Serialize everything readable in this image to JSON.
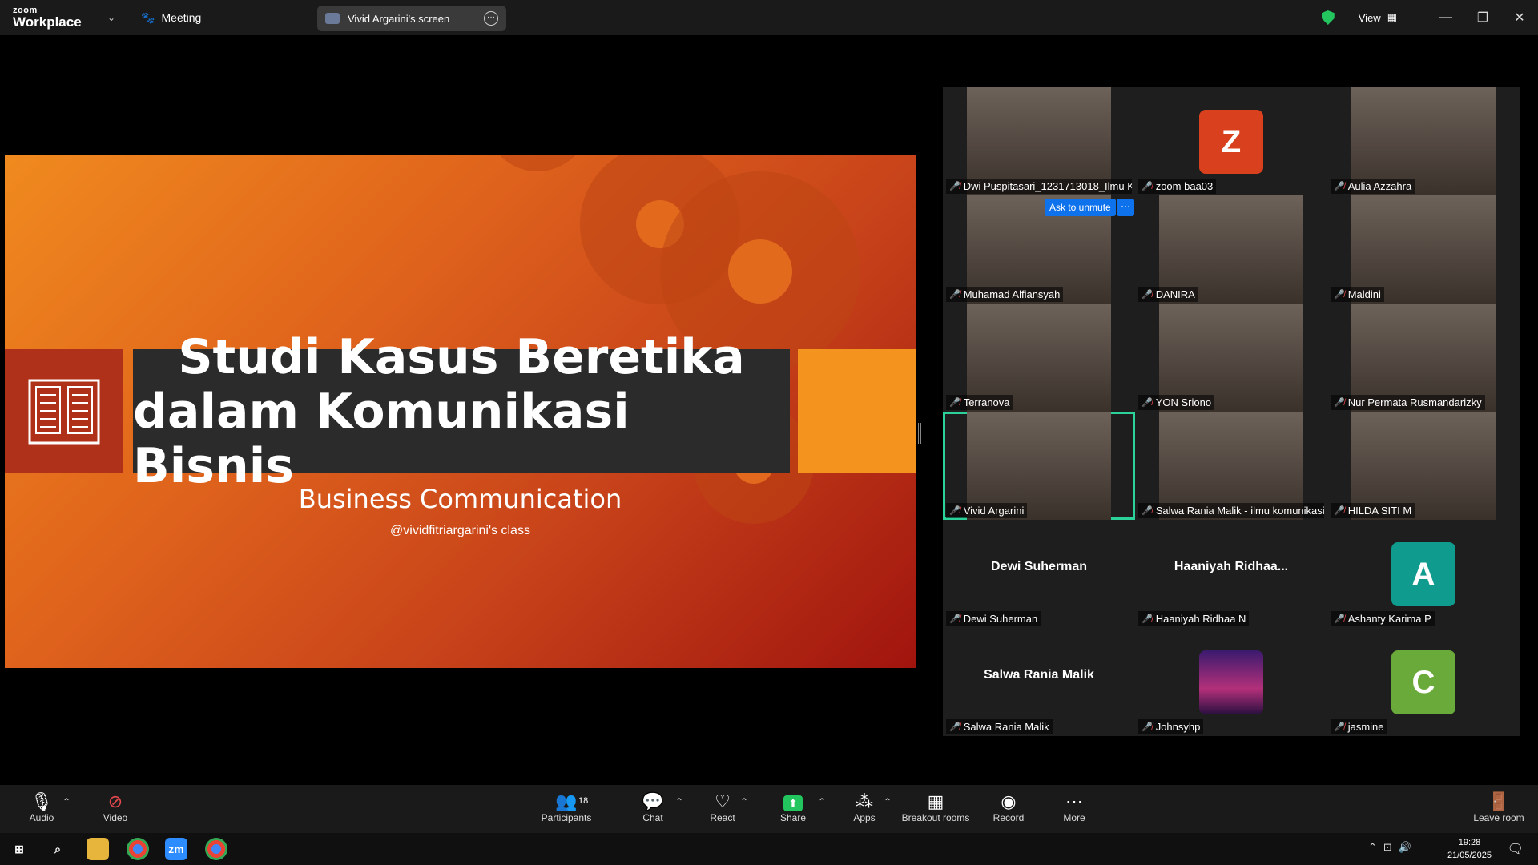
{
  "app": {
    "logo_top": "zoom",
    "logo_bottom": "Workplace",
    "meeting_label": "Meeting"
  },
  "share_pill": {
    "label": "Vivid Argarini's screen"
  },
  "header": {
    "view_label": "View"
  },
  "slide": {
    "title_line1": "Studi Kasus Beretika",
    "title_line2": "dalam Komunikasi Bisnis",
    "subtitle": "Business Communication",
    "handle": "@vividfitriargarini's class"
  },
  "gallery": {
    "ask_to_unmute": "Ask to unmute",
    "tiles": [
      {
        "name": "Dwi Puspitasari_1231713018_Ilmu K...",
        "kind": "video"
      },
      {
        "name": "zoom baa03",
        "kind": "avatar",
        "initial": "Z",
        "color": "#d9411e"
      },
      {
        "name": "Aulia Azzahra",
        "kind": "video"
      },
      {
        "name": "Muhamad Alfiansyah",
        "kind": "video"
      },
      {
        "name": "DANIRA",
        "kind": "video"
      },
      {
        "name": "Maldini",
        "kind": "video"
      },
      {
        "name": "Terranova",
        "kind": "video"
      },
      {
        "name": "YON Sriono",
        "kind": "video"
      },
      {
        "name": "Nur Permata Rusmandarizky",
        "kind": "video"
      },
      {
        "name": "Vivid Argarini",
        "kind": "video",
        "active": true
      },
      {
        "name": "Salwa Rania Malik - ilmu komunikasi",
        "kind": "video"
      },
      {
        "name": "HILDA SITI M",
        "kind": "video"
      },
      {
        "name": "Dewi Suherman",
        "kind": "text",
        "display": "Dewi Suherman"
      },
      {
        "name": "Haaniyah Ridhaa N",
        "kind": "text",
        "display": "Haaniyah  Ridhaa..."
      },
      {
        "name": "Ashanty Karima P",
        "kind": "avatar",
        "initial": "A",
        "color": "#0f9b8e"
      },
      {
        "name": "Salwa Rania Malik",
        "kind": "text",
        "display": "Salwa Rania Malik"
      },
      {
        "name": "Johnsyhp",
        "kind": "image"
      },
      {
        "name": "jasmine",
        "kind": "avatar",
        "initial": "C",
        "color": "#6aaa3a"
      }
    ]
  },
  "toolbar": {
    "audio": "Audio",
    "video": "Video",
    "participants": "Participants",
    "participants_count": "18",
    "chat": "Chat",
    "react": "React",
    "share": "Share",
    "apps": "Apps",
    "breakout": "Breakout rooms",
    "record": "Record",
    "more": "More",
    "leave": "Leave room"
  },
  "taskbar": {
    "time": "19:28",
    "date": "21/05/2025",
    "zoom_label": "zm"
  }
}
